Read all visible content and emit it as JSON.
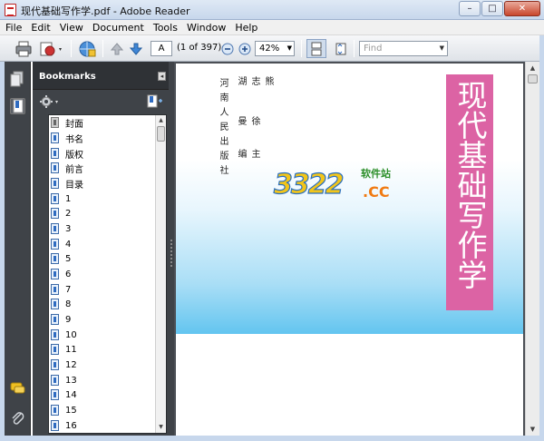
{
  "window": {
    "title": "现代基础写作学.pdf - Adobe Reader",
    "minimize": "–",
    "maximize": "□",
    "close": "✕"
  },
  "menu": [
    "File",
    "Edit",
    "View",
    "Document",
    "Tools",
    "Window",
    "Help"
  ],
  "toolbar": {
    "page_input": "A",
    "page_count": "(1 of 397)",
    "zoom": "42%",
    "find_placeholder": "Find"
  },
  "bookmarks": {
    "header": "Bookmarks",
    "items": [
      "封面",
      "书名",
      "版权",
      "前言",
      "目录",
      "1",
      "2",
      "3",
      "4",
      "5",
      "6",
      "7",
      "8",
      "9",
      "10",
      "11",
      "12",
      "13",
      "14",
      "15",
      "16"
    ]
  },
  "document": {
    "authors": [
      "熊志湖",
      "徐曼",
      "主编"
    ],
    "publisher": "河南人民出版社",
    "book_title": "现代基础写作学",
    "watermark_number": "3322",
    "watermark_domain": ".CC",
    "watermark_tag": "软件站"
  },
  "colors": {
    "panel_bg": "#3f4348",
    "title_bar": "#c7d7ec",
    "book_title_bar": "#dc63a4",
    "page_gradient_bottom": "#5ec3ef"
  }
}
